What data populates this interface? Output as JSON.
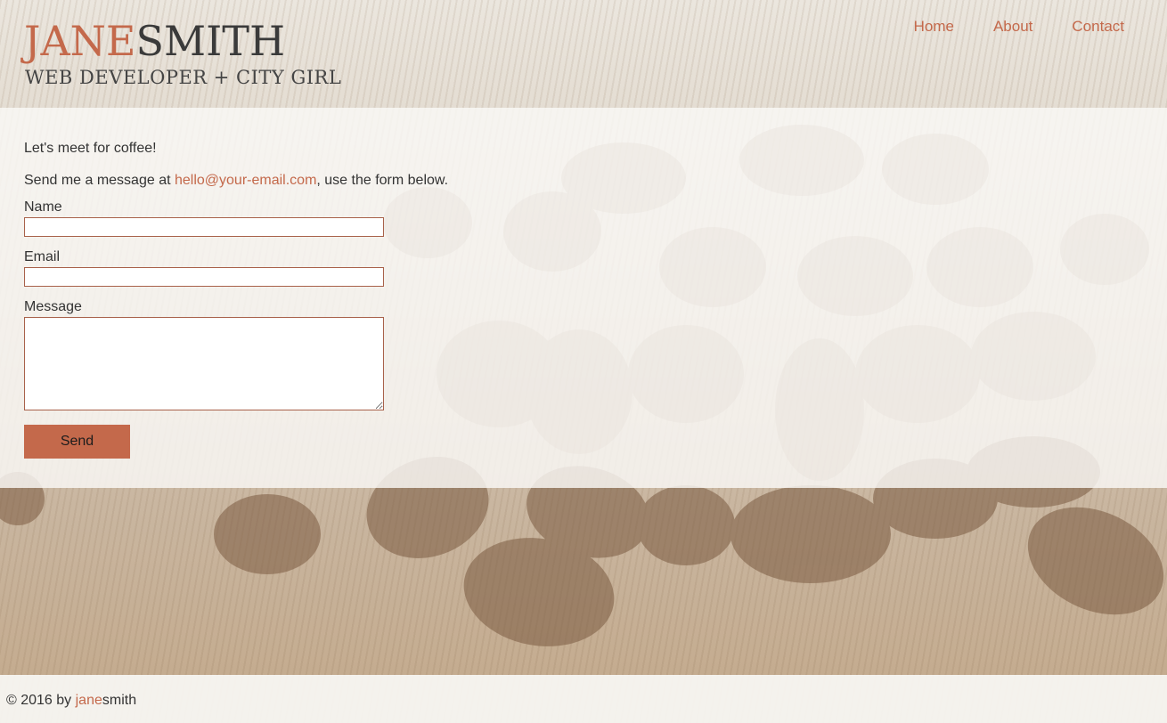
{
  "brand": {
    "first": "JANE",
    "last": "SMITH",
    "tagline": "WEB DEVELOPER + CITY GIRL"
  },
  "nav": {
    "home": "Home",
    "about": "About",
    "contact": "Contact"
  },
  "main": {
    "intro": "Let's meet for coffee!",
    "send_prefix": "Send me a message at ",
    "email": "hello@your-email.com",
    "send_suffix": ", use the form below.",
    "form": {
      "name_label": "Name",
      "name_value": "",
      "email_label": "Email",
      "email_value": "",
      "message_label": "Message",
      "message_value": "",
      "submit_label": "Send"
    }
  },
  "footer": {
    "copy_prefix": "© 2016 by ",
    "first": "jane",
    "last": "smith"
  },
  "colors": {
    "accent": "#c4694b",
    "text": "#3a3a3a",
    "border": "#a8614a"
  }
}
